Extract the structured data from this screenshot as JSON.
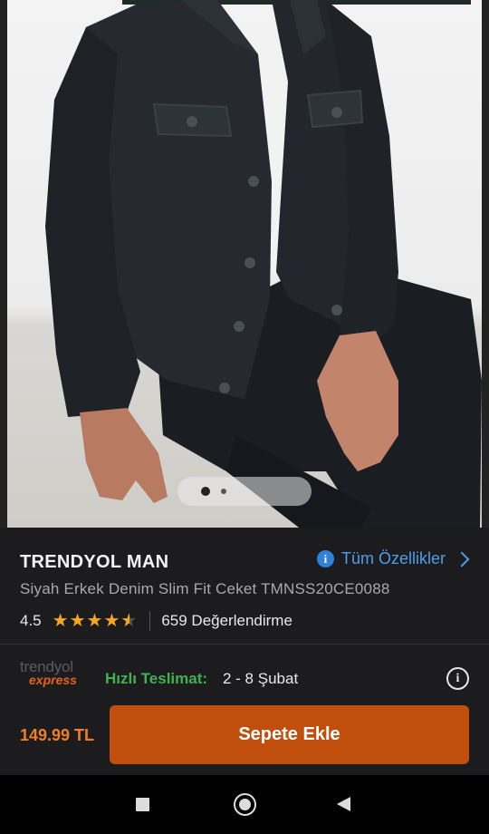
{
  "product": {
    "brand": "TRENDYOL MAN",
    "name": "Siyah Erkek Denim Slim Fit Ceket TMNSS20CE0088",
    "all_features_label": "Tüm Özellikler",
    "rating": "4.5",
    "rating_stars": 4.5,
    "review_count_label": "659 Değerlendirme"
  },
  "gallery": {
    "image_icon": "product-photo-denim-jacket",
    "total_images": 2,
    "active_index": 1
  },
  "delivery": {
    "logo_top": "trendyol",
    "logo_bottom": "express",
    "fast_label": "Hızlı Teslimat:",
    "dates": "2 - 8 Şubat"
  },
  "cart": {
    "price": "149.99 TL",
    "button_label": "Sepete Ekle"
  },
  "colors": {
    "accent_orange": "#c04f0d",
    "price_orange": "#f07e2a",
    "link_blue": "#4d9ee8",
    "fast_green": "#3fb34f"
  },
  "navbar": {
    "recent_icon": "square-icon",
    "home_icon": "circle-home-icon",
    "back_icon": "triangle-back-icon"
  }
}
